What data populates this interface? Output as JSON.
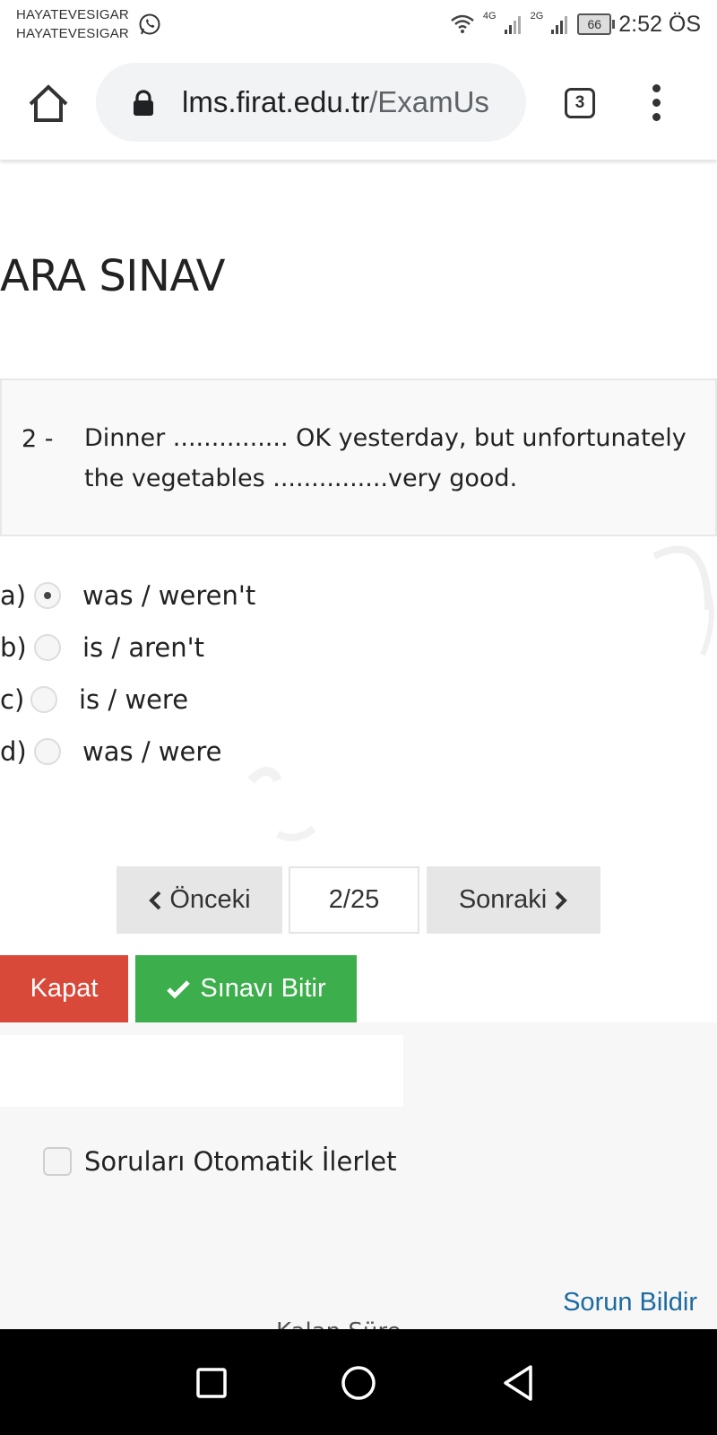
{
  "status_bar": {
    "notification_line1": "HAYATEVESIGAR",
    "notification_line2": "HAYATEVESIGAR",
    "net1": "4G",
    "net2": "2G",
    "battery": "66",
    "time": "2:52 ÖS"
  },
  "browser": {
    "url_host": "lms.firat.edu.tr",
    "url_path": "/ExamUs",
    "tab_count": "3"
  },
  "page": {
    "title": "ARA SINAV",
    "question_number": "2 -",
    "question_text": "Dinner ............... OK yesterday, but unfortunately the vegetables ...............very good.",
    "options": [
      {
        "letter": "a)",
        "text": "was / weren't",
        "selected": true
      },
      {
        "letter": "b)",
        "text": "is / aren't",
        "selected": false
      },
      {
        "letter": "c)",
        "text": "is / were",
        "selected": false
      },
      {
        "letter": "d)",
        "text": "was / were",
        "selected": false
      }
    ],
    "prev_label": "Önceki",
    "page_indicator": "2/25",
    "next_label": "Sonraki",
    "close_label": "Kapat",
    "finish_label": "Sınavı Bitir",
    "auto_advance_label": "Soruları Otomatik İlerlet",
    "report_label": "Sorun Bildir",
    "cut_text": "Kalan Süre"
  },
  "colors": {
    "close_button": "#d9493a",
    "finish_button": "#3cae4b",
    "link": "#1c6aa0"
  }
}
